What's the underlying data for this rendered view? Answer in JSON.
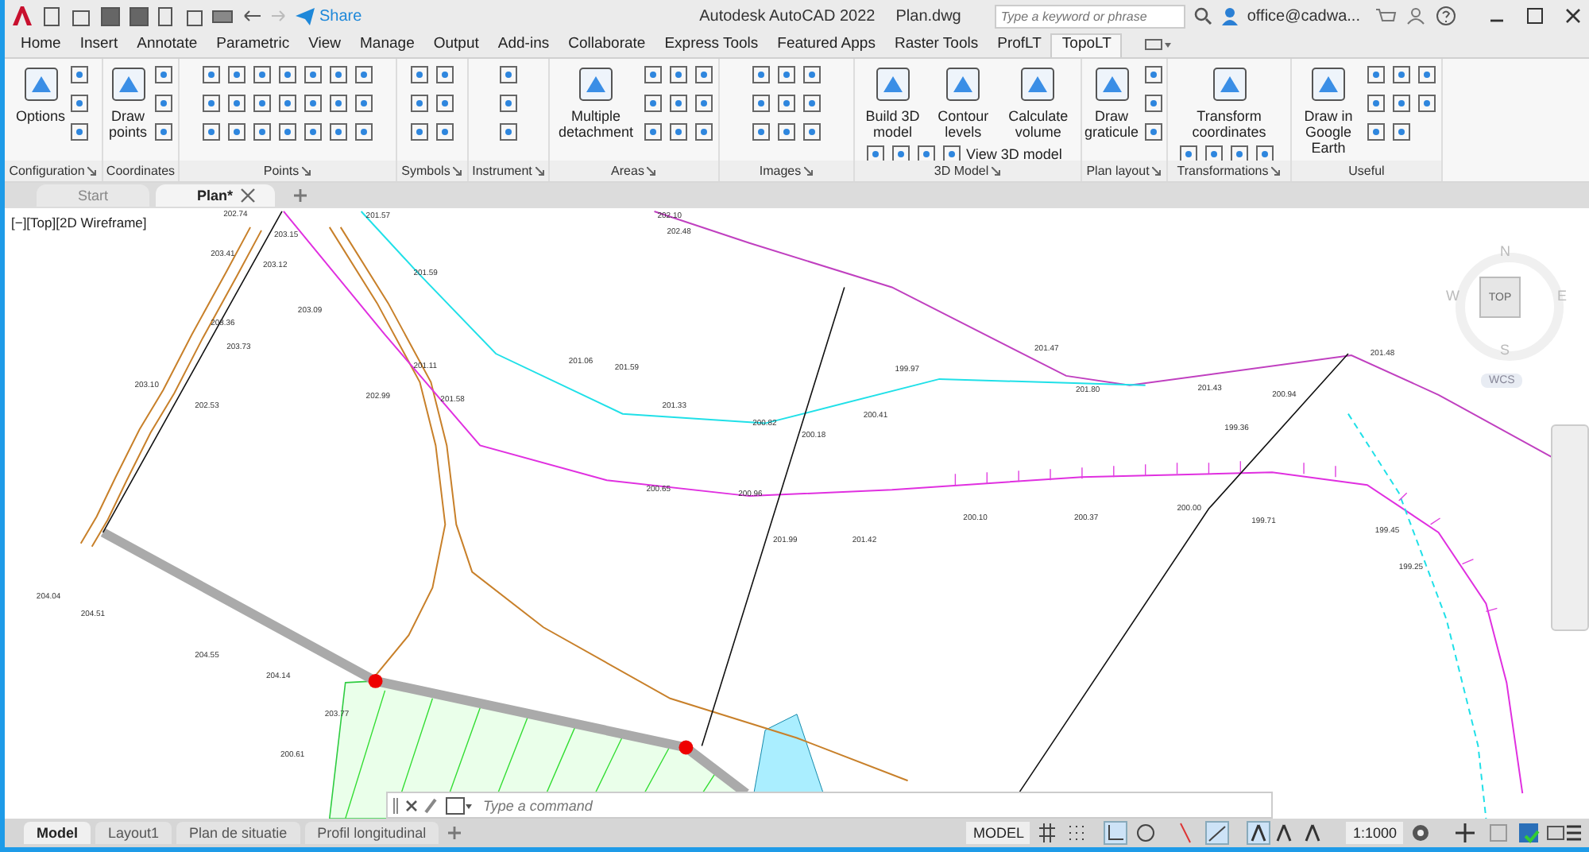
{
  "title_bar": {
    "share": "Share",
    "app_title": "Autodesk AutoCAD 2022",
    "file_name": "Plan.dwg",
    "search": {
      "placeholder": "Type a keyword or phrase"
    },
    "user": "office@cadwa..."
  },
  "ribbon_tabs": [
    {
      "label": "Home",
      "selected": false
    },
    {
      "label": "Insert",
      "selected": false
    },
    {
      "label": "Annotate",
      "selected": false
    },
    {
      "label": "Parametric",
      "selected": false
    },
    {
      "label": "View",
      "selected": false
    },
    {
      "label": "Manage",
      "selected": false
    },
    {
      "label": "Output",
      "selected": false
    },
    {
      "label": "Add-ins",
      "selected": false
    },
    {
      "label": "Collaborate",
      "selected": false
    },
    {
      "label": "Express Tools",
      "selected": false
    },
    {
      "label": "Featured Apps",
      "selected": false
    },
    {
      "label": "Raster Tools",
      "selected": false
    },
    {
      "label": "ProfLT",
      "selected": false
    },
    {
      "label": "TopoLT",
      "selected": true
    }
  ],
  "panels": [
    {
      "title": "Configuration",
      "launcher": true,
      "buttons": [
        {
          "kind": "large",
          "label": "Options"
        }
      ]
    },
    {
      "title": "Coordinates",
      "launcher": false,
      "buttons": [
        {
          "kind": "large",
          "label": "Draw points"
        }
      ]
    },
    {
      "title": "Points",
      "launcher": true
    },
    {
      "title": "Symbols",
      "launcher": true
    },
    {
      "title": "Instrument",
      "launcher": true
    },
    {
      "title": "Areas",
      "launcher": true,
      "buttons": [
        {
          "kind": "large",
          "label": "Multiple detachment"
        }
      ]
    },
    {
      "title": "Images",
      "launcher": true
    },
    {
      "title": "3D Model",
      "launcher": true,
      "buttons": [
        {
          "kind": "large",
          "label": "Build 3D model"
        },
        {
          "kind": "large",
          "label": "Contour levels"
        },
        {
          "kind": "large",
          "label": "Calculate volume"
        },
        {
          "kind": "small",
          "label": "View 3D model"
        }
      ]
    },
    {
      "title": "Plan layout",
      "launcher": true,
      "buttons": [
        {
          "kind": "large",
          "label": "Draw graticule"
        }
      ]
    },
    {
      "title": "Transformations",
      "launcher": true,
      "buttons": [
        {
          "kind": "large",
          "label": "Transform coordinates"
        }
      ]
    },
    {
      "title": "Useful",
      "launcher": false,
      "buttons": [
        {
          "kind": "large",
          "label": "Draw in Google Earth"
        }
      ]
    }
  ],
  "file_tabs": [
    {
      "label": "Start",
      "selected": false
    },
    {
      "label": "Plan*",
      "selected": true
    }
  ],
  "viewport": {
    "label": "[−][Top][2D Wireframe]",
    "viewcube": {
      "north": "N",
      "south": "S",
      "east": "E",
      "west": "W",
      "face": "TOP",
      "ucs": "WCS"
    }
  },
  "elevations": [
    "202.74",
    "203.41",
    "201.57",
    "202.10",
    "202.48",
    "203.15",
    "203.12",
    "203.09",
    "201.59",
    "203.36",
    "203.73",
    "203.10",
    "202.53",
    "202.99",
    "201.11",
    "201.58",
    "201.06",
    "201.59",
    "201.33",
    "200.82",
    "200.18",
    "199.97",
    "200.41",
    "201.47",
    "201.80",
    "201.43",
    "201.48",
    "200.94",
    "199.36",
    "200.65",
    "200.96",
    "200.37",
    "200.00",
    "200.10",
    "199.71",
    "199.45",
    "199.25",
    "204.04",
    "204.51",
    "204.55",
    "204.14",
    "203.77",
    "200.61",
    "201.99",
    "201.42"
  ],
  "command_line": {
    "placeholder": "Type a command"
  },
  "layout_tabs": [
    {
      "label": "Model",
      "selected": true
    },
    {
      "label": "Layout1",
      "selected": false
    },
    {
      "label": "Plan de situatie",
      "selected": false
    },
    {
      "label": "Profil longitudinal",
      "selected": false
    }
  ],
  "status_bar": {
    "space": "MODEL",
    "scale": "1:1000"
  }
}
